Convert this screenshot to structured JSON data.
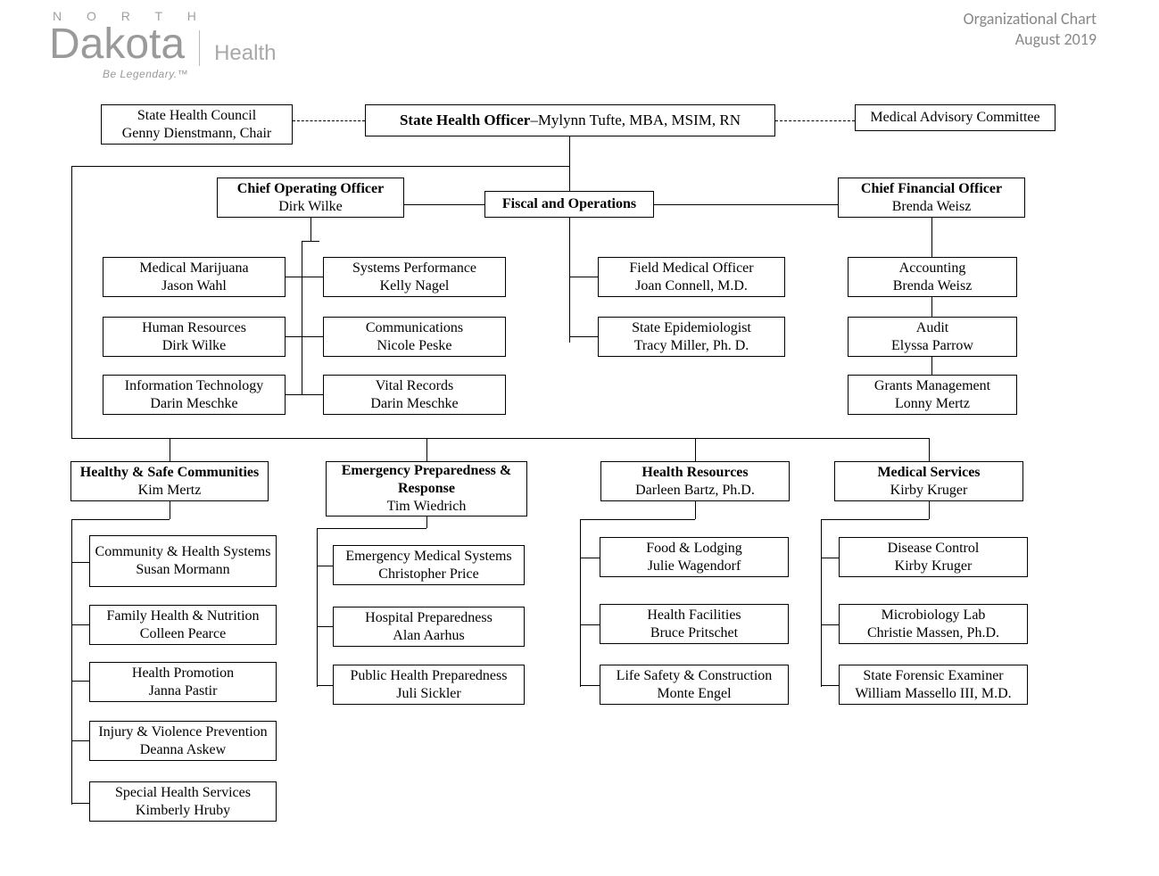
{
  "header": {
    "title_line1": "Organizational Chart",
    "title_line2": "August 2019",
    "logo_north": "N O R T H",
    "logo_dakota": "Dakota",
    "logo_health": "Health",
    "logo_tagline": "Be Legendary.™"
  },
  "top_row": {
    "state_health_council": {
      "line1": "State Health Council",
      "line2": "Genny Dienstmann, Chair"
    },
    "state_health_officer": {
      "title_bold": "State Health Officer",
      "dash": "–",
      "name": "Mylynn Tufte, MBA, MSIM, RN"
    },
    "medical_advisory": {
      "line1": "Medical Advisory Committee"
    }
  },
  "second_row": {
    "coo": {
      "title": "Chief Operating Officer",
      "name": "Dirk Wilke"
    },
    "fiscal_ops": {
      "title": "Fiscal and Operations"
    },
    "cfo": {
      "title": "Chief Financial Officer",
      "name": "Brenda Weisz"
    }
  },
  "coo_children": {
    "left": [
      {
        "title": "Medical Marijuana",
        "name": "Jason Wahl"
      },
      {
        "title": "Human Resources",
        "name": "Dirk Wilke"
      },
      {
        "title": "Information Technology",
        "name": "Darin Meschke"
      }
    ],
    "right": [
      {
        "title": "Systems Performance",
        "name": "Kelly Nagel"
      },
      {
        "title": "Communications",
        "name": "Nicole Peske"
      },
      {
        "title": "Vital Records",
        "name": "Darin Meschke"
      }
    ]
  },
  "fiscal_children": [
    {
      "title": "Field Medical Officer",
      "name": "Joan Connell, M.D."
    },
    {
      "title": "State Epidemiologist",
      "name": "Tracy Miller, Ph. D."
    }
  ],
  "cfo_children": [
    {
      "title": "Accounting",
      "name": "Brenda Weisz"
    },
    {
      "title": "Audit",
      "name": "Elyssa Parrow"
    },
    {
      "title": "Grants Management",
      "name": "Lonny Mertz"
    }
  ],
  "divisions": {
    "healthy": {
      "title": "Healthy & Safe Communities",
      "name": "Kim Mertz",
      "children": [
        {
          "title": "Community & Health Systems",
          "name": "Susan Mormann"
        },
        {
          "title": "Family Health & Nutrition",
          "name": "Colleen Pearce"
        },
        {
          "title": "Health Promotion",
          "name": "Janna Pastir"
        },
        {
          "title": "Injury & Violence Prevention",
          "name": "Deanna Askew"
        },
        {
          "title": "Special Health Services",
          "name": "Kimberly Hruby"
        }
      ]
    },
    "epr": {
      "title": "Emergency Preparedness & Response",
      "name": "Tim Wiedrich",
      "children": [
        {
          "title": "Emergency Medical Systems",
          "name": "Christopher Price"
        },
        {
          "title": "Hospital Preparedness",
          "name": "Alan Aarhus"
        },
        {
          "title": "Public Health Preparedness",
          "name": "Juli Sickler"
        }
      ]
    },
    "hr": {
      "title": "Health Resources",
      "name": "Darleen Bartz, Ph.D.",
      "children": [
        {
          "title": "Food & Lodging",
          "name": "Julie Wagendorf"
        },
        {
          "title": "Health Facilities",
          "name": "Bruce Pritschet"
        },
        {
          "title": "Life Safety & Construction",
          "name": "Monte Engel"
        }
      ]
    },
    "ms": {
      "title": "Medical Services",
      "name": "Kirby Kruger",
      "children": [
        {
          "title": "Disease Control",
          "name": "Kirby Kruger"
        },
        {
          "title": "Microbiology Lab",
          "name": "Christie Massen, Ph.D."
        },
        {
          "title": "State Forensic Examiner",
          "name": "William Massello III, M.D."
        }
      ]
    }
  }
}
